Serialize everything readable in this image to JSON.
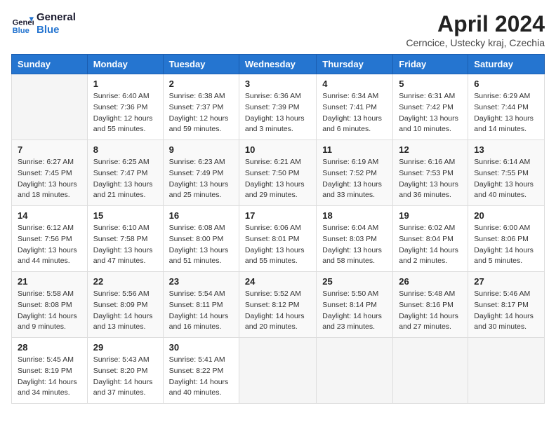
{
  "header": {
    "logo_line1": "General",
    "logo_line2": "Blue",
    "month_title": "April 2024",
    "location": "Cerncice, Ustecky kraj, Czechia"
  },
  "days_of_week": [
    "Sunday",
    "Monday",
    "Tuesday",
    "Wednesday",
    "Thursday",
    "Friday",
    "Saturday"
  ],
  "weeks": [
    [
      {
        "day": "",
        "info": ""
      },
      {
        "day": "1",
        "info": "Sunrise: 6:40 AM\nSunset: 7:36 PM\nDaylight: 12 hours\nand 55 minutes."
      },
      {
        "day": "2",
        "info": "Sunrise: 6:38 AM\nSunset: 7:37 PM\nDaylight: 12 hours\nand 59 minutes."
      },
      {
        "day": "3",
        "info": "Sunrise: 6:36 AM\nSunset: 7:39 PM\nDaylight: 13 hours\nand 3 minutes."
      },
      {
        "day": "4",
        "info": "Sunrise: 6:34 AM\nSunset: 7:41 PM\nDaylight: 13 hours\nand 6 minutes."
      },
      {
        "day": "5",
        "info": "Sunrise: 6:31 AM\nSunset: 7:42 PM\nDaylight: 13 hours\nand 10 minutes."
      },
      {
        "day": "6",
        "info": "Sunrise: 6:29 AM\nSunset: 7:44 PM\nDaylight: 13 hours\nand 14 minutes."
      }
    ],
    [
      {
        "day": "7",
        "info": "Sunrise: 6:27 AM\nSunset: 7:45 PM\nDaylight: 13 hours\nand 18 minutes."
      },
      {
        "day": "8",
        "info": "Sunrise: 6:25 AM\nSunset: 7:47 PM\nDaylight: 13 hours\nand 21 minutes."
      },
      {
        "day": "9",
        "info": "Sunrise: 6:23 AM\nSunset: 7:49 PM\nDaylight: 13 hours\nand 25 minutes."
      },
      {
        "day": "10",
        "info": "Sunrise: 6:21 AM\nSunset: 7:50 PM\nDaylight: 13 hours\nand 29 minutes."
      },
      {
        "day": "11",
        "info": "Sunrise: 6:19 AM\nSunset: 7:52 PM\nDaylight: 13 hours\nand 33 minutes."
      },
      {
        "day": "12",
        "info": "Sunrise: 6:16 AM\nSunset: 7:53 PM\nDaylight: 13 hours\nand 36 minutes."
      },
      {
        "day": "13",
        "info": "Sunrise: 6:14 AM\nSunset: 7:55 PM\nDaylight: 13 hours\nand 40 minutes."
      }
    ],
    [
      {
        "day": "14",
        "info": "Sunrise: 6:12 AM\nSunset: 7:56 PM\nDaylight: 13 hours\nand 44 minutes."
      },
      {
        "day": "15",
        "info": "Sunrise: 6:10 AM\nSunset: 7:58 PM\nDaylight: 13 hours\nand 47 minutes."
      },
      {
        "day": "16",
        "info": "Sunrise: 6:08 AM\nSunset: 8:00 PM\nDaylight: 13 hours\nand 51 minutes."
      },
      {
        "day": "17",
        "info": "Sunrise: 6:06 AM\nSunset: 8:01 PM\nDaylight: 13 hours\nand 55 minutes."
      },
      {
        "day": "18",
        "info": "Sunrise: 6:04 AM\nSunset: 8:03 PM\nDaylight: 13 hours\nand 58 minutes."
      },
      {
        "day": "19",
        "info": "Sunrise: 6:02 AM\nSunset: 8:04 PM\nDaylight: 14 hours\nand 2 minutes."
      },
      {
        "day": "20",
        "info": "Sunrise: 6:00 AM\nSunset: 8:06 PM\nDaylight: 14 hours\nand 5 minutes."
      }
    ],
    [
      {
        "day": "21",
        "info": "Sunrise: 5:58 AM\nSunset: 8:08 PM\nDaylight: 14 hours\nand 9 minutes."
      },
      {
        "day": "22",
        "info": "Sunrise: 5:56 AM\nSunset: 8:09 PM\nDaylight: 14 hours\nand 13 minutes."
      },
      {
        "day": "23",
        "info": "Sunrise: 5:54 AM\nSunset: 8:11 PM\nDaylight: 14 hours\nand 16 minutes."
      },
      {
        "day": "24",
        "info": "Sunrise: 5:52 AM\nSunset: 8:12 PM\nDaylight: 14 hours\nand 20 minutes."
      },
      {
        "day": "25",
        "info": "Sunrise: 5:50 AM\nSunset: 8:14 PM\nDaylight: 14 hours\nand 23 minutes."
      },
      {
        "day": "26",
        "info": "Sunrise: 5:48 AM\nSunset: 8:16 PM\nDaylight: 14 hours\nand 27 minutes."
      },
      {
        "day": "27",
        "info": "Sunrise: 5:46 AM\nSunset: 8:17 PM\nDaylight: 14 hours\nand 30 minutes."
      }
    ],
    [
      {
        "day": "28",
        "info": "Sunrise: 5:45 AM\nSunset: 8:19 PM\nDaylight: 14 hours\nand 34 minutes."
      },
      {
        "day": "29",
        "info": "Sunrise: 5:43 AM\nSunset: 8:20 PM\nDaylight: 14 hours\nand 37 minutes."
      },
      {
        "day": "30",
        "info": "Sunrise: 5:41 AM\nSunset: 8:22 PM\nDaylight: 14 hours\nand 40 minutes."
      },
      {
        "day": "",
        "info": ""
      },
      {
        "day": "",
        "info": ""
      },
      {
        "day": "",
        "info": ""
      },
      {
        "day": "",
        "info": ""
      }
    ]
  ]
}
